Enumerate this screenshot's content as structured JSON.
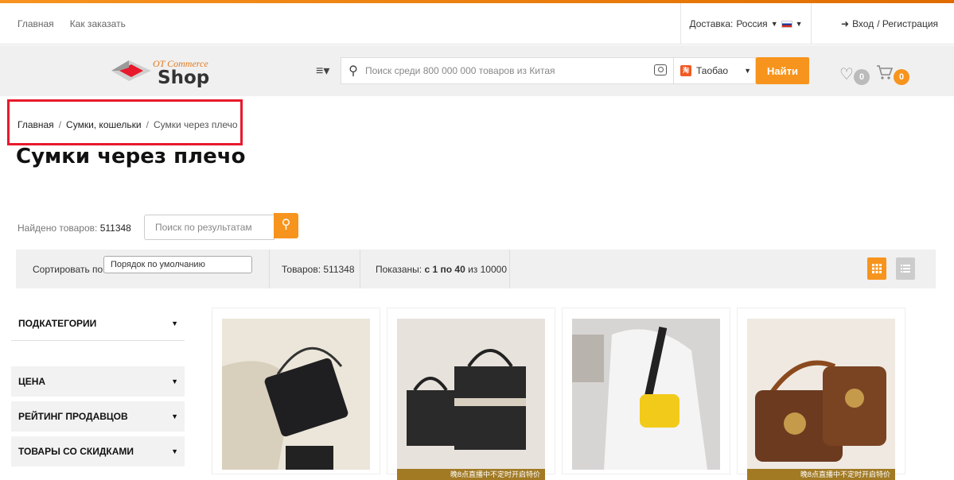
{
  "topbar": {
    "links": [
      "Главная",
      "Как заказать"
    ],
    "delivery_label": "Доставка:",
    "delivery_country": "Россия",
    "login": "Вход",
    "register": "/ Регистрация"
  },
  "header": {
    "logo_line1": "OT Commerce",
    "logo_line2": "Shop",
    "menu_icon": "≡▾",
    "search_placeholder": "Поиск среди 800 000 000 товаров из Китая",
    "provider": "Таобао",
    "provider_icon_text": "淘",
    "find_button": "Найти",
    "favorites_count": "0",
    "cart_count": "0"
  },
  "breadcrumb": {
    "items": [
      "Главная",
      "Сумки, кошельки",
      "Сумки через плечо"
    ],
    "separator": "/"
  },
  "page_title": "Сумки через плечо",
  "results": {
    "found_label": "Найдено товаров:",
    "found_count": "511348",
    "search_placeholder": "Поиск по результатам"
  },
  "sortbar": {
    "sort_label": "Сортировать по:",
    "sort_value": "Порядок по умолчанию",
    "items_label": "Товаров: 511348",
    "shown_prefix": "Показаны:",
    "shown_range": "с 1 по 40",
    "shown_suffix": "из 10000"
  },
  "sidebar": {
    "items": [
      "ПОДКАТЕГОРИИ",
      "ЦЕНА",
      "РЕЙТИНГ ПРОДАВЦОВ",
      "ТОВАРЫ СО СКИДКАМИ"
    ]
  },
  "products": {
    "ribbon_text": "晚8点直播中不定时开启特价"
  },
  "colors": {
    "accent": "#f7941d",
    "highlight": "#e8192c"
  }
}
